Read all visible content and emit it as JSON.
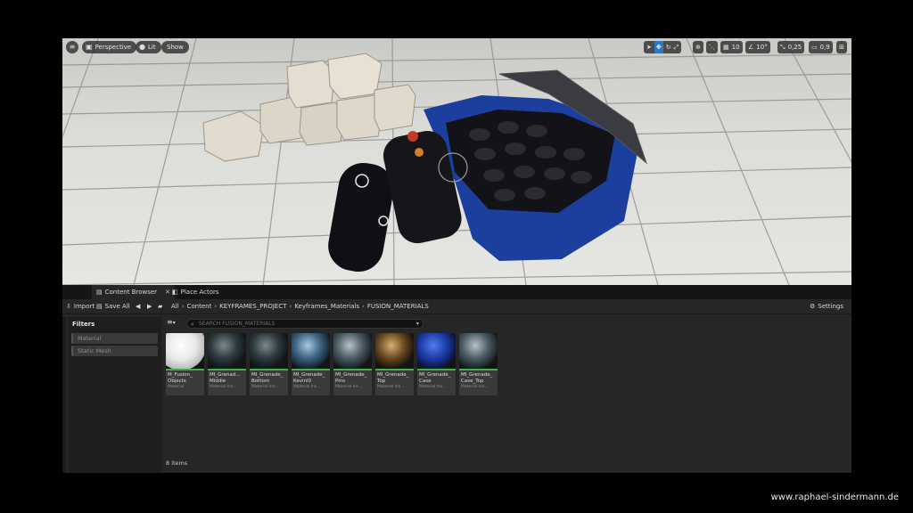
{
  "viewport": {
    "menu_icon": "hamburger-icon",
    "perspective_label": "Perspective",
    "lit_label": "Lit",
    "show_label": "Show",
    "grid_snap_value": "10",
    "rotation_snap_value": "10°",
    "scale_snap_value": "0,25",
    "camera_speed_value": "0,9"
  },
  "tabs": [
    {
      "label": "Content Browser",
      "icon": "content-browser-icon",
      "active": true
    },
    {
      "label": "Place Actors",
      "icon": "place-actors-icon",
      "active": false
    }
  ],
  "toolbar": {
    "import_label": "Import",
    "save_all_label": "Save All",
    "breadcrumb": [
      "All",
      "Content",
      "KEYFRAMES_PROJECT",
      "Keyframes_Materials",
      "FUSION_MATERIALS"
    ],
    "settings_label": "Settings"
  },
  "filters": {
    "title": "Filters",
    "items": [
      "Material",
      "Static Mesh"
    ]
  },
  "search": {
    "placeholder": "Search FUSION_MATERIALS"
  },
  "assets": [
    {
      "name1": "M_Fusion_",
      "name2": "Objects",
      "type": "Material",
      "thumb": "white-sphere"
    },
    {
      "name1": "MI_Grenad...",
      "name2": "Middle",
      "type": "Material Ins...",
      "thumb": "dark-sphere"
    },
    {
      "name1": "MI_Grenade_",
      "name2": "Bottom",
      "type": "Material Ins...",
      "thumb": "dark-sphere"
    },
    {
      "name1": "MI_Grenade_",
      "name2": "Kevinl0",
      "type": "Material Ins...",
      "thumb": "blue-sphere"
    },
    {
      "name1": "MI_Grenade_",
      "name2": "Pins",
      "type": "Material Ins...",
      "thumb": "grey-sphere"
    },
    {
      "name1": "MI_Grenade_",
      "name2": "Top",
      "type": "Material Ins...",
      "thumb": "bronze-sphere"
    },
    {
      "name1": "MI_Grenade_",
      "name2": "Case",
      "type": "Material Ins...",
      "thumb": "deepblue-sphere"
    },
    {
      "name1": "MI_Grenade_",
      "name2": "Case_Top",
      "type": "Material Ins...",
      "thumb": "grey-sphere"
    }
  ],
  "item_count": "8 items",
  "watermark": "www.raphael-sindermann.de",
  "colors": {
    "accent": "#2a78c8",
    "asset_bar": "#3fae4f",
    "panel": "#262626"
  }
}
